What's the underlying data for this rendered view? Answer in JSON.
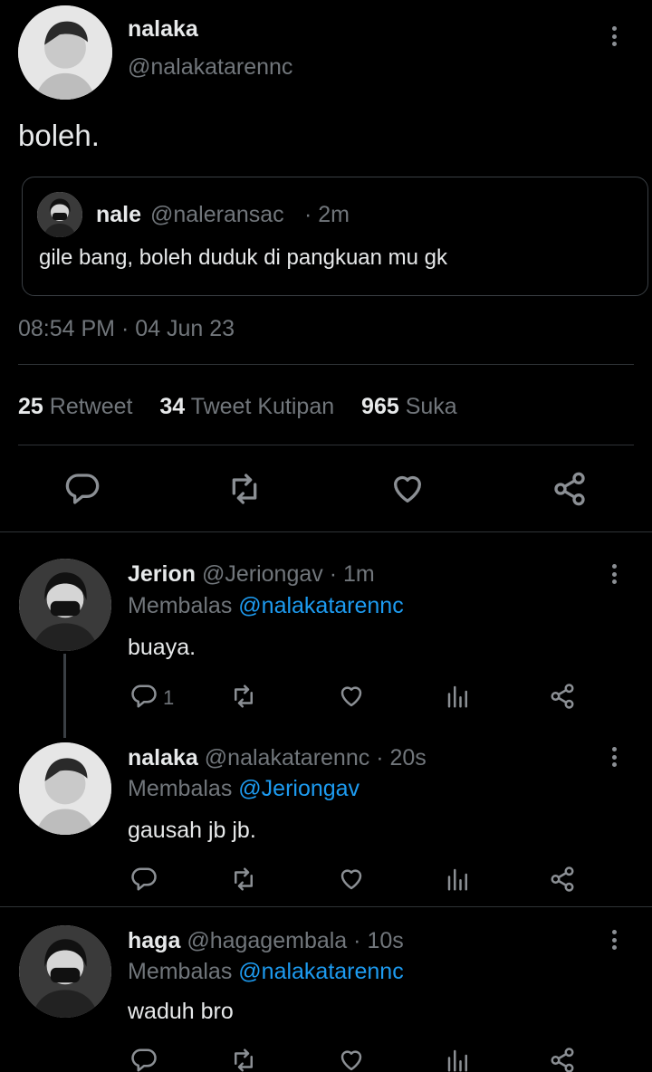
{
  "main_tweet": {
    "author_name": "nalaka",
    "author_handle": "@nalakatarennc",
    "text": "boleh.",
    "quote": {
      "name": "nale",
      "handle": "@naleransac",
      "time": "· 2m",
      "text": "gile bang, boleh duduk di pangkuan mu gk"
    },
    "timestamp": "08:54 PM · 04 Jun 23",
    "stats": {
      "retweets_count": "25",
      "retweets_label": "Retweet",
      "quotes_count": "34",
      "quotes_label": "Tweet Kutipan",
      "likes_count": "965",
      "likes_label": "Suka"
    },
    "actions": [
      "reply-icon",
      "retweet-icon",
      "like-icon",
      "share-icon"
    ]
  },
  "replies": [
    {
      "name": "Jerion",
      "handle": "@Jeriongav",
      "time": "· 1m",
      "replying_prefix": "Membalas",
      "replying_to": "@nalakatarennc",
      "text": "buaya.",
      "reply_count": "1"
    },
    {
      "name": "nalaka",
      "handle": "@nalakatarennc",
      "time": "· 20s",
      "replying_prefix": "Membalas",
      "replying_to": "@Jeriongav",
      "text": "gausah jb jb."
    },
    {
      "name": "haga",
      "handle": "@hagagembala",
      "time": "· 10s",
      "replying_prefix": "Membalas",
      "replying_to": "@nalakatarennc",
      "text": "waduh bro"
    }
  ]
}
